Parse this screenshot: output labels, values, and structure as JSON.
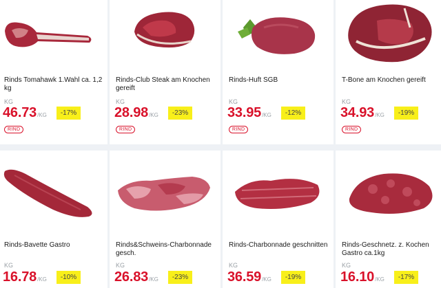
{
  "products": [
    {
      "name": "Rinds Tomahawk 1.Wahl ca. 1,2 kg",
      "unit": "KG",
      "price": "46.73",
      "per": "/KG",
      "discount": "-17%",
      "tag": "RIND"
    },
    {
      "name": "Rinds-Club Steak am Knochen gereift",
      "unit": "KG",
      "price": "28.98",
      "per": "/KG",
      "discount": "-23%",
      "tag": "RIND"
    },
    {
      "name": "Rinds-Huft SGB",
      "unit": "KG",
      "price": "33.95",
      "per": "/KG",
      "discount": "-12%",
      "tag": "RIND"
    },
    {
      "name": "T-Bone am Knochen gereift",
      "unit": "KG",
      "price": "34.93",
      "per": "/KG",
      "discount": "-19%",
      "tag": "RIND"
    },
    {
      "name": "Rinds-Bavette Gastro",
      "unit": "KG",
      "price": "16.78",
      "per": "/KG",
      "discount": "-10%"
    },
    {
      "name": "Rinds&Schweins-Charbonnade gesch.",
      "unit": "KG",
      "price": "26.83",
      "per": "/KG",
      "discount": "-23%"
    },
    {
      "name": "Rinds-Charbonnade geschnitten",
      "unit": "KG",
      "price": "36.59",
      "per": "/KG",
      "discount": "-19%"
    },
    {
      "name": "Rinds-Geschnetz. z. Kochen Gastro ca.1kg",
      "unit": "KG",
      "price": "16.10",
      "per": "/KG",
      "discount": "-17%"
    }
  ],
  "colors": {
    "price": "#d9112a",
    "badge": "#f8ef1a",
    "meat": "#b3273a"
  }
}
